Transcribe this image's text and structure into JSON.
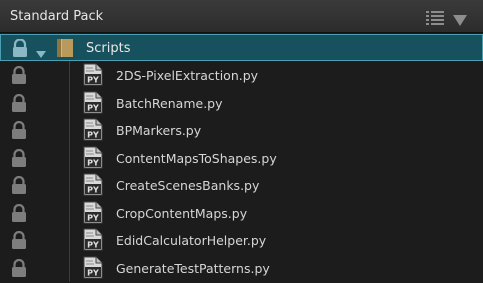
{
  "panel": {
    "title": "Standard Pack",
    "icons": {
      "list": "list-view-icon",
      "collapse": "collapse-triangle-icon",
      "lock": "lock-icon",
      "folder": "folder-icon",
      "file": "python-file-icon"
    }
  },
  "tree": {
    "folder": {
      "label": "Scripts",
      "expanded": true,
      "selected": true
    },
    "files": [
      {
        "label": "2DS-PixelExtraction.py"
      },
      {
        "label": "BatchRename.py"
      },
      {
        "label": "BPMarkers.py"
      },
      {
        "label": "ContentMapsToShapes.py"
      },
      {
        "label": "CreateScenesBanks.py"
      },
      {
        "label": "CropContentMaps.py"
      },
      {
        "label": "EdidCalculatorHelper.py"
      },
      {
        "label": "GenerateTestPatterns.py"
      }
    ]
  },
  "colors": {
    "selection": "#17515e",
    "selection_border": "#4aa0b2",
    "lock": "#8a8a8a"
  }
}
